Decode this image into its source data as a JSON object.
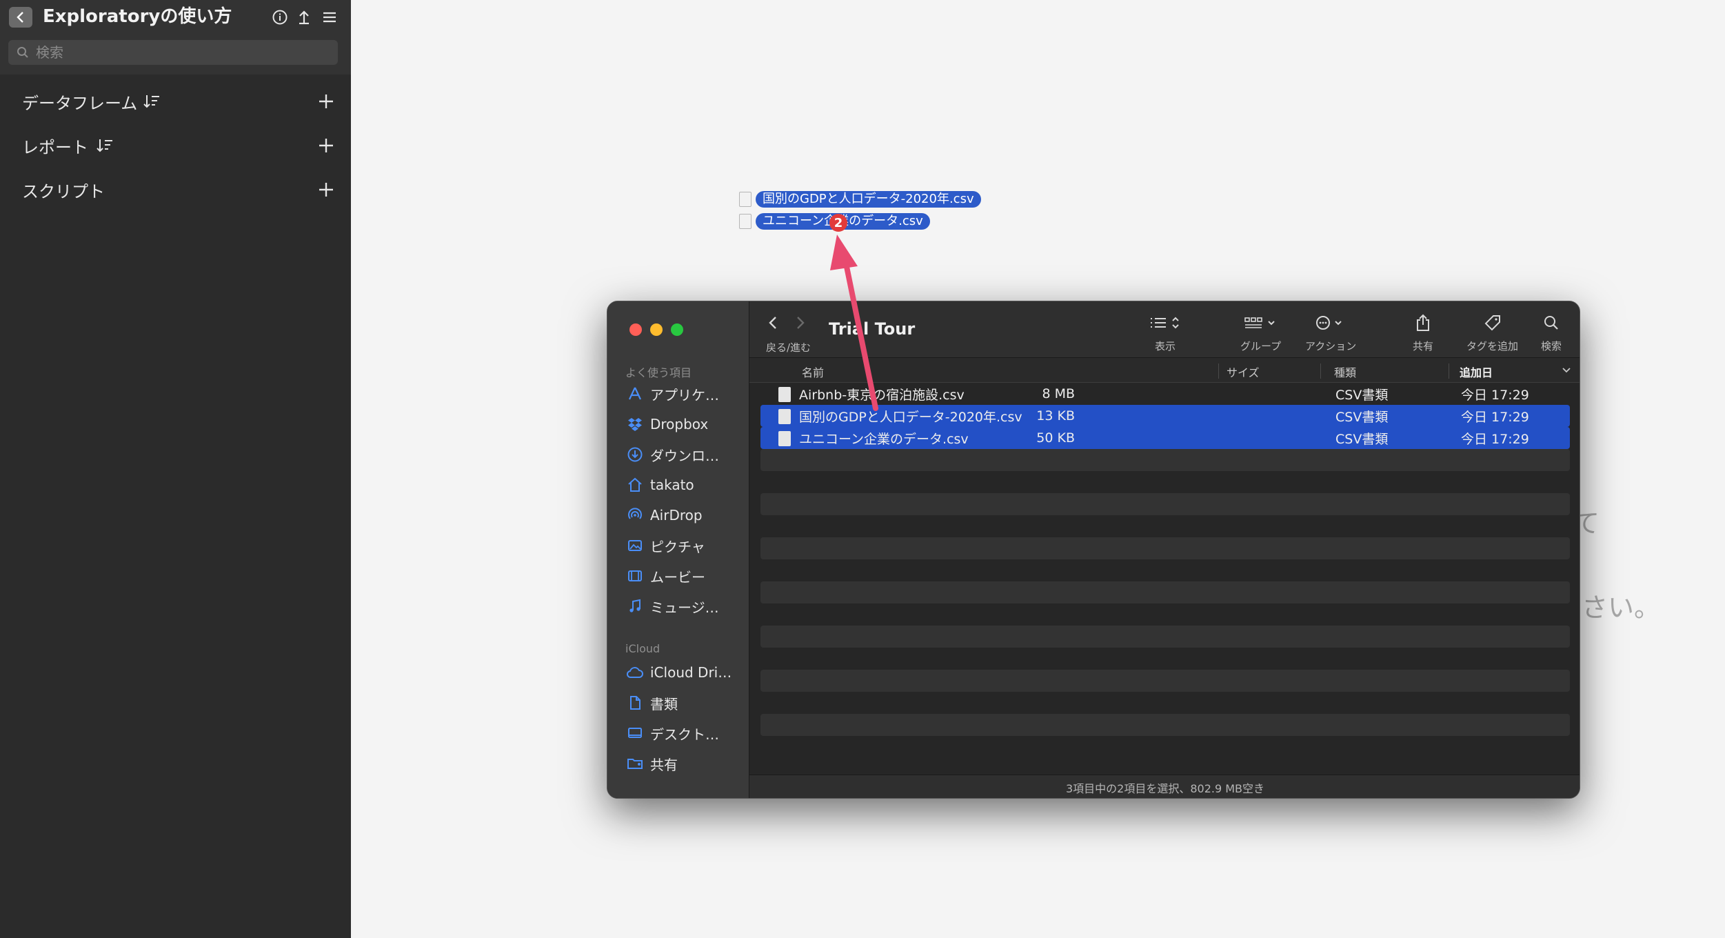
{
  "app": {
    "title": "Exploratoryの使い方",
    "search_placeholder": "検索",
    "sections": [
      {
        "label": "データフレーム"
      },
      {
        "label": "レポート"
      },
      {
        "label": "スクリプト"
      }
    ]
  },
  "background": {
    "text_line1": "て",
    "text_line2": "さい。"
  },
  "drag": {
    "items": [
      "国別のGDPと人口データ-2020年.csv",
      "ユニコーン企業のデータ.csv"
    ],
    "badge_count": "2"
  },
  "finder": {
    "sidebar": {
      "favorites_heading": "よく使う項目",
      "favorites": [
        {
          "label": "アプリケ…",
          "icon": "apps-icon"
        },
        {
          "label": "Dropbox",
          "icon": "dropbox-icon"
        },
        {
          "label": "ダウンロ…",
          "icon": "download-icon"
        },
        {
          "label": "takato",
          "icon": "home-icon"
        },
        {
          "label": "AirDrop",
          "icon": "airdrop-icon"
        },
        {
          "label": "ピクチャ",
          "icon": "pictures-icon"
        },
        {
          "label": "ムービー",
          "icon": "movies-icon"
        },
        {
          "label": "ミュージ…",
          "icon": "music-icon"
        }
      ],
      "icloud_heading": "iCloud",
      "icloud": [
        {
          "label": "iCloud Dri…",
          "icon": "cloud-icon"
        },
        {
          "label": "書類",
          "icon": "document-icon"
        },
        {
          "label": "デスクト…",
          "icon": "desktop-icon"
        },
        {
          "label": "共有",
          "icon": "shared-folder-icon"
        }
      ]
    },
    "toolbar": {
      "title": "Trial Tour",
      "nav_label": "戻る/進む",
      "view_label": "表示",
      "group_label": "グループ",
      "action_label": "アクション",
      "share_label": "共有",
      "tag_label": "タグを追加",
      "search_label": "検索"
    },
    "columns": {
      "name": "名前",
      "size": "サイズ",
      "kind": "種類",
      "date_added": "追加日"
    },
    "files": [
      {
        "name": "Airbnb-東京の宿泊施設.csv",
        "size": "8 MB",
        "kind": "CSV書類",
        "date": "今日 17:29",
        "selected": false
      },
      {
        "name": "国別のGDPと人口データ-2020年.csv",
        "size": "13 KB",
        "kind": "CSV書類",
        "date": "今日 17:29",
        "selected": true
      },
      {
        "name": "ユニコーン企業のデータ.csv",
        "size": "50 KB",
        "kind": "CSV書類",
        "date": "今日 17:29",
        "selected": true
      }
    ],
    "status": "3項目中の2項目を選択、802.9 MB空き"
  },
  "colors": {
    "selection": "#2350c6",
    "arrow": "#e84a6f",
    "badge": "#e23b3b"
  }
}
